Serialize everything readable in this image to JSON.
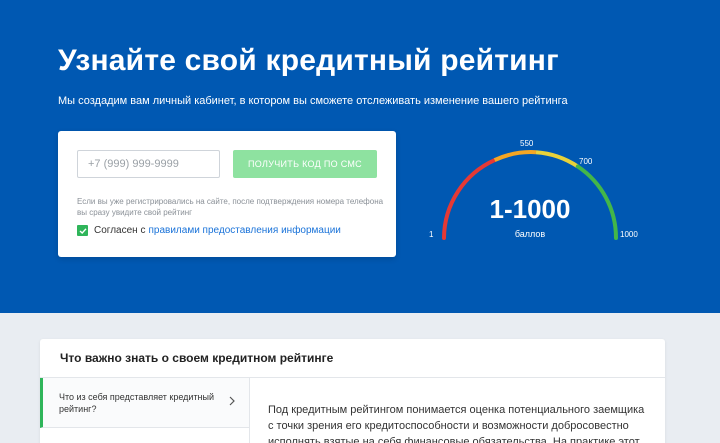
{
  "hero": {
    "title": "Узнайте свой кредитный рейтинг",
    "subtitle": "Мы создадим вам личный кабинет, в котором вы сможете отслеживать изменение вашего рейтинга"
  },
  "form": {
    "phone_placeholder": "+7 (999) 999-9999",
    "sms_button": "ПОЛУЧИТЬ КОД ПО СМС",
    "hint": "Если вы уже регистрировались на сайте, после подтверждения номера телефона вы сразу увидите свой рейтинг",
    "agree_prefix": "Согласен с",
    "agree_link": "правилами предоставления информации",
    "agree_checked": true
  },
  "gauge": {
    "value": "1-1000",
    "unit": "баллов",
    "ticks": [
      "1",
      "550",
      "700",
      "1000"
    ],
    "colors": [
      "#e53935",
      "#f5a623",
      "#e8d23a",
      "#43b649"
    ]
  },
  "faq": {
    "title": "Что важно знать о своем кредитном рейтинге",
    "items": [
      {
        "label": "Что из себя представляет кредитный рейтинг?"
      }
    ],
    "answer": "Под кредитным рейтингом понимается оценка потенциального заемщика с точки зрения его кредитоспособности и возможности добросовестно исполнять взятые на себя финансовые обязательства. На практике этот"
  },
  "accent": "#0058b2"
}
